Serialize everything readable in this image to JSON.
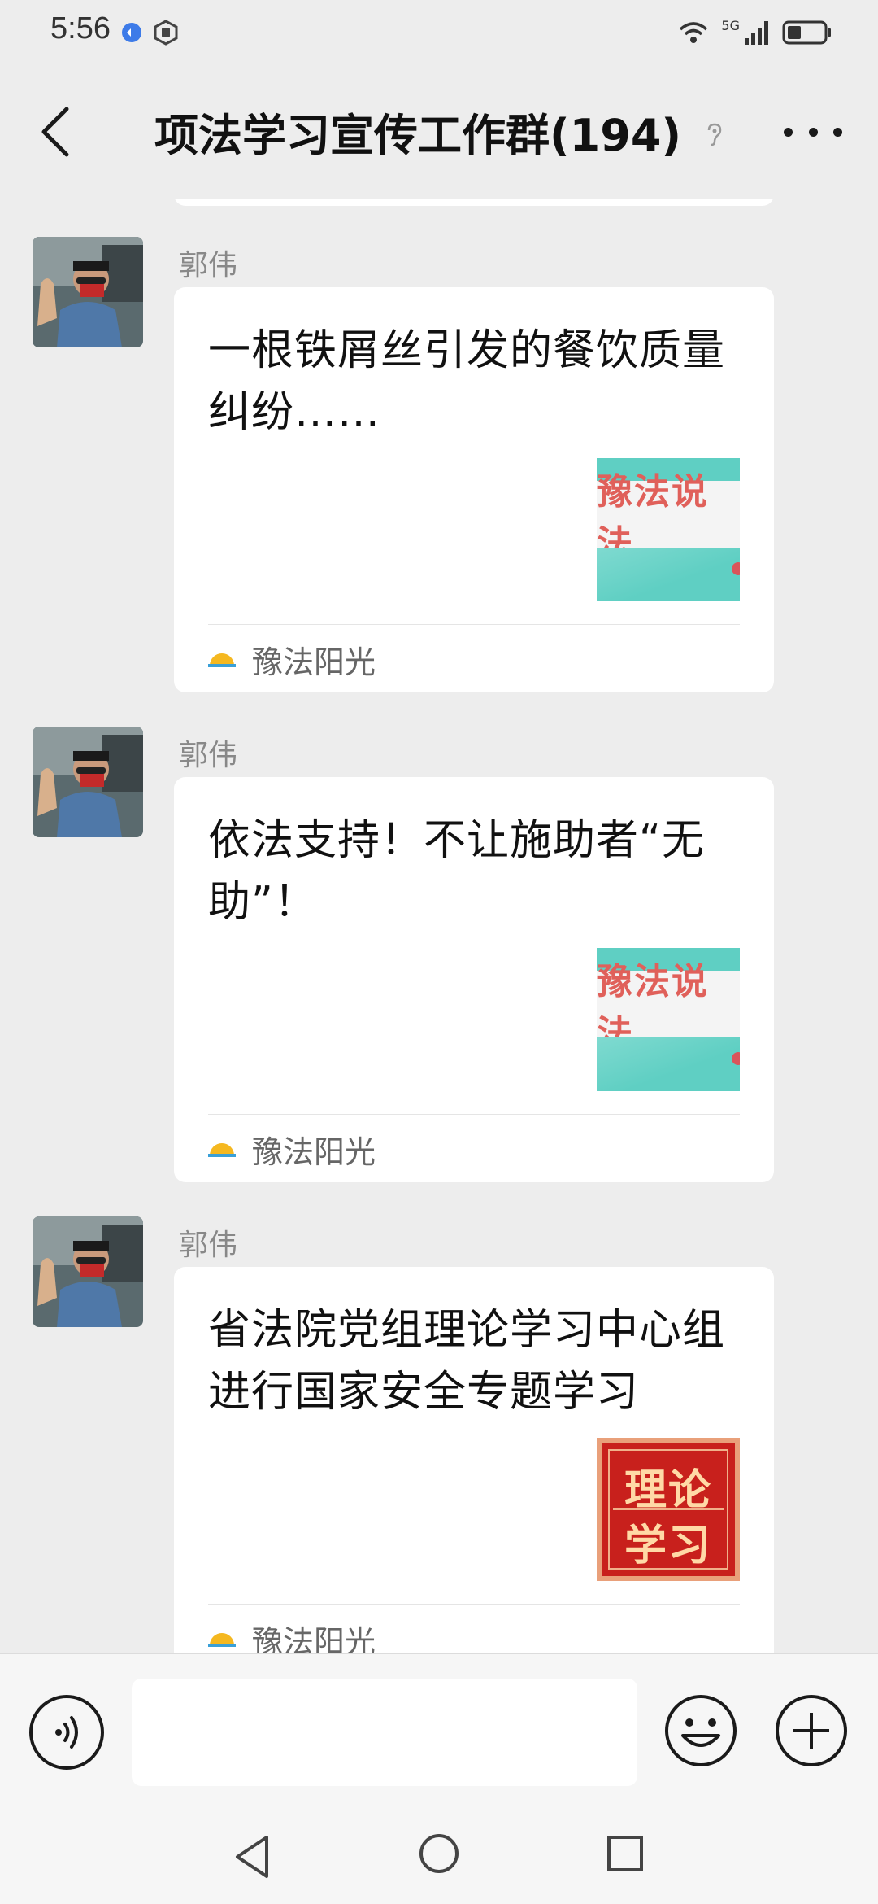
{
  "status_bar": {
    "time": "5:56",
    "network_label": "5G",
    "battery_level": 0.35
  },
  "header": {
    "title": "项法学习宣传工作群(194)",
    "back_icon": "chevron-left-icon",
    "mute_icon": "ear-icon",
    "more_icon": "more-dots-icon"
  },
  "messages": [
    {
      "sender": "郭伟",
      "title": "一根铁屑丝引发的餐饮质量纠纷……",
      "thumb_text": "豫法说法",
      "source": "豫法阳光"
    },
    {
      "sender": "郭伟",
      "title": "依法支持！不让施助者“无助”！",
      "thumb_text": "豫法说法",
      "source": "豫法阳光"
    },
    {
      "sender": "郭伟",
      "title": "省法院党组理论学习中心组进行国家安全专题学习",
      "thumb_line1": "理论",
      "thumb_line2": "学习",
      "source": "豫法阳光"
    }
  ],
  "input_bar": {
    "voice_icon": "voice-icon",
    "emoji_icon": "emoji-icon",
    "plus_icon": "plus-icon",
    "message_value": ""
  },
  "colors": {
    "background": "#ededed",
    "card": "#ffffff",
    "thumb_teal": "#5fcfc3",
    "thumb_red": "#c8201c"
  }
}
